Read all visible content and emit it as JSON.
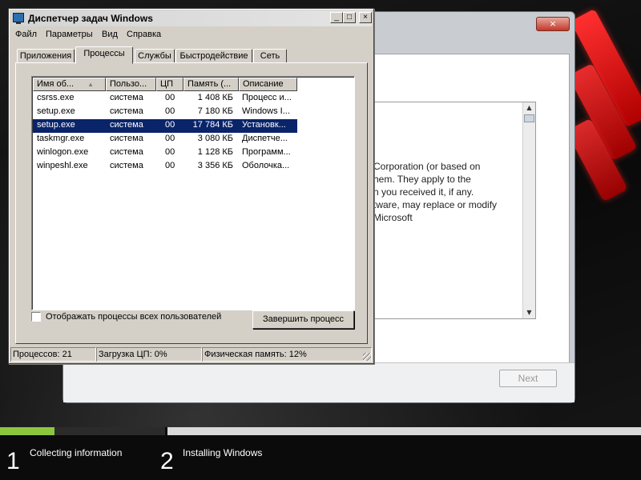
{
  "task_manager": {
    "title": "Диспетчер задач Windows",
    "title_buttons": [
      "_",
      "□",
      "×"
    ],
    "menu": [
      "Файл",
      "Параметры",
      "Вид",
      "Справка"
    ],
    "tabs": [
      "Приложения",
      "Процессы",
      "Службы",
      "Быстродействие",
      "Сеть"
    ],
    "active_tab": "Процессы",
    "columns": [
      "Имя об...",
      "Пользо...",
      "ЦП",
      "Память (...",
      "Описание"
    ],
    "processes": [
      {
        "name": "csrss.exe",
        "user": "система",
        "cpu": "00",
        "memory": "1 408 КБ",
        "description": "Процесс и...",
        "selected": false
      },
      {
        "name": "setup.exe",
        "user": "система",
        "cpu": "00",
        "memory": "7 180 КБ",
        "description": "Windows I...",
        "selected": false
      },
      {
        "name": "setup.exe",
        "user": "система",
        "cpu": "00",
        "memory": "17 784 КБ",
        "description": "Установк...",
        "selected": true
      },
      {
        "name": "taskmgr.exe",
        "user": "система",
        "cpu": "00",
        "memory": "3 080 КБ",
        "description": "Диспетче...",
        "selected": false
      },
      {
        "name": "winlogon.exe",
        "user": "система",
        "cpu": "00",
        "memory": "1 128 КБ",
        "description": "Программ...",
        "selected": false
      },
      {
        "name": "winpeshl.exe",
        "user": "система",
        "cpu": "00",
        "memory": "3 356 КБ",
        "description": "Оболочка...",
        "selected": false
      }
    ],
    "show_all_users_label": "Отображать процессы всех пользователей",
    "show_all_users_checked": false,
    "end_process_label": "Завершить процесс",
    "status": {
      "processes": "Процессов: 21",
      "cpu": "Загрузка ЦП: 0%",
      "memory": "Физическая память: 12%"
    }
  },
  "setup_window": {
    "close_glyph": "×",
    "license_lines": [
      "Corporation (or based on",
      "hem. They apply to the",
      "n you received it, if any.",
      "tware, may replace or modify",
      "Microsoft"
    ],
    "next_label": "Next"
  },
  "progress": {
    "steps": [
      {
        "number": "1",
        "label": "Collecting information"
      },
      {
        "number": "2",
        "label": "Installing Windows"
      }
    ],
    "step1_fraction": 0.33,
    "fill_color": "#8cc63f"
  }
}
